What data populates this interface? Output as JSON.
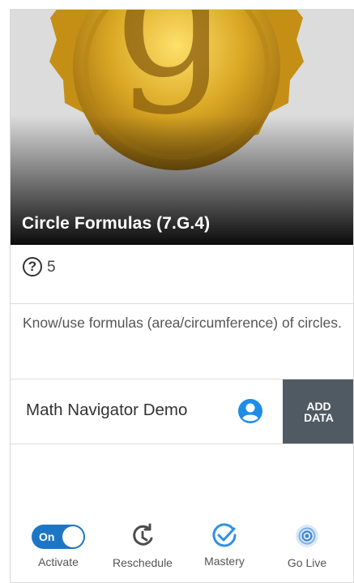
{
  "card": {
    "title": "Circle Formulas (7.G.4)",
    "question_count": "5",
    "description": "Know/use formulas (area/circumference) of circles.",
    "class_name": "Math Navigator Demo",
    "add_data_line1": "ADD",
    "add_data_line2": "DATA"
  },
  "actions": {
    "toggle_state": "On",
    "activate": "Activate",
    "reschedule": "Reschedule",
    "mastery": "Mastery",
    "go_live": "Go Live"
  },
  "colors": {
    "accent": "#1d76c5",
    "add_data_bg": "#505a62",
    "go_live": "#3f86d6"
  },
  "icons": {
    "badge": "gold-g-coin-icon",
    "question": "question-circle-icon",
    "person": "person-circle-icon",
    "reschedule": "clock-refresh-icon",
    "mastery": "check-circle-icon",
    "go_live": "broadcast-icon"
  }
}
